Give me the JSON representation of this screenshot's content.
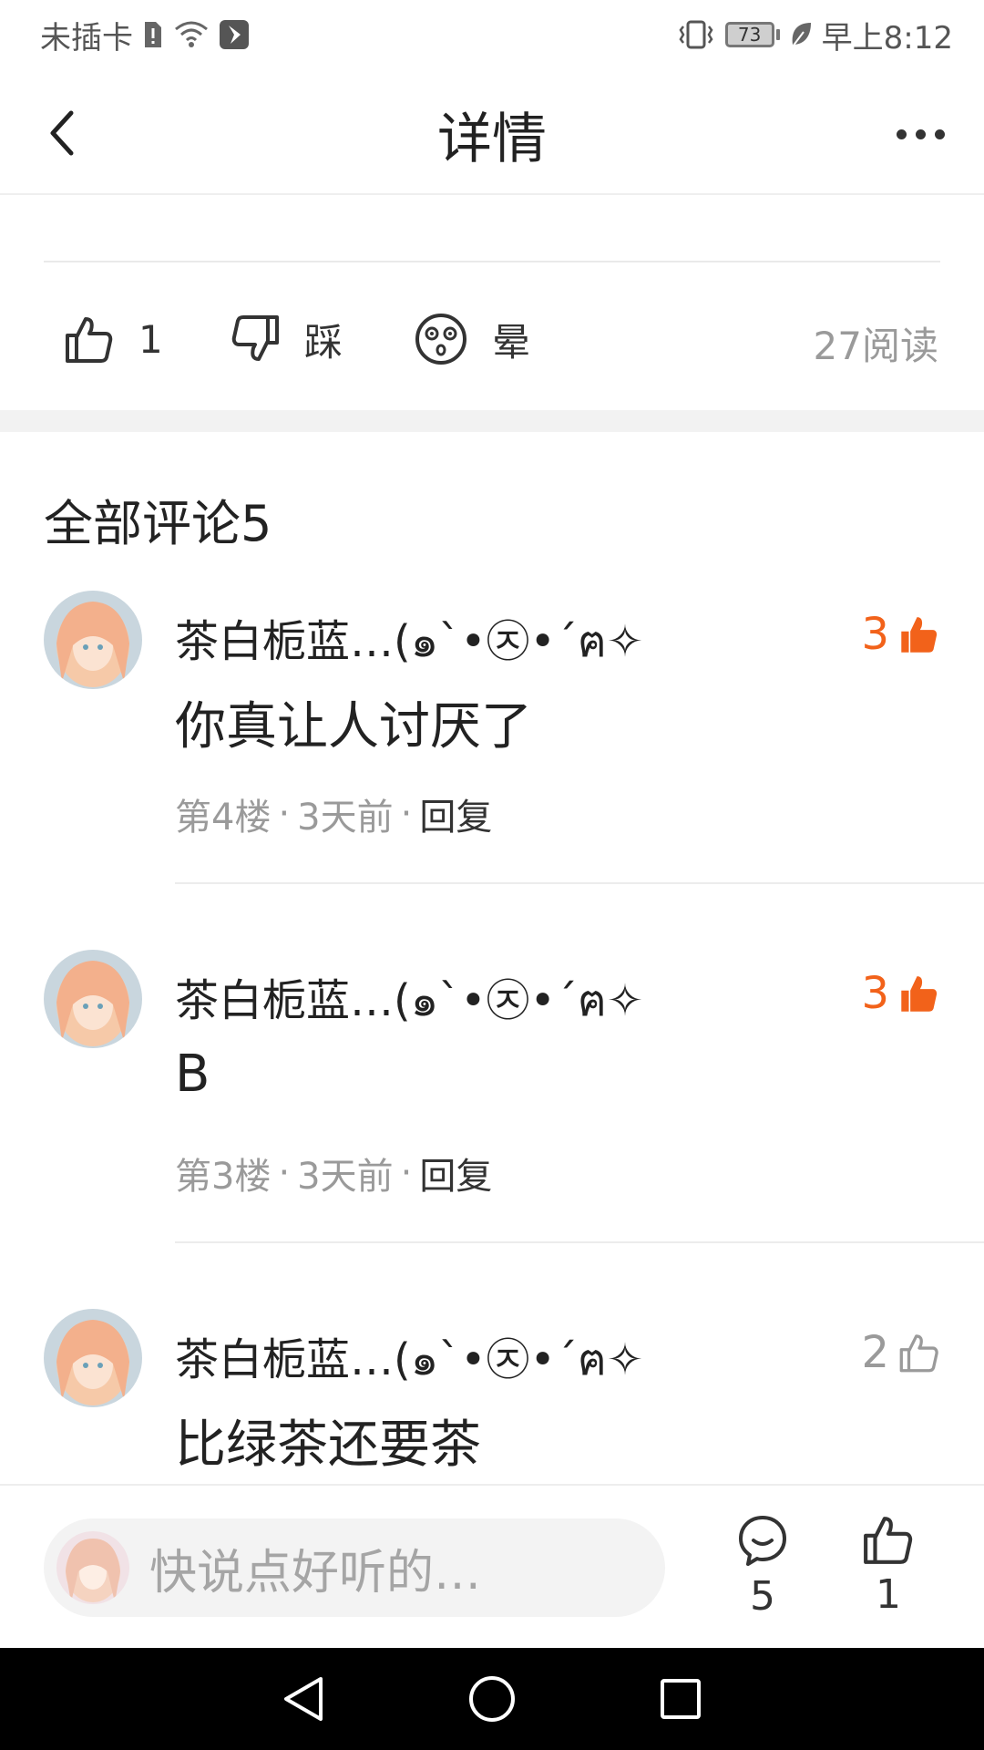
{
  "status_bar": {
    "carrier": "未插卡",
    "battery": "73",
    "time": "早上8:12"
  },
  "header": {
    "title": "详情"
  },
  "reactions": {
    "like_count": "1",
    "dislike_label": "踩",
    "dizzy_label": "晕",
    "read_count": "27阅读"
  },
  "comments_section": {
    "title": "全部评论5"
  },
  "comments": [
    {
      "name": "茶白栀蓝…(๑`•㉨•´ฅ✧",
      "text": "你真让人讨厌了",
      "floor": "第4楼",
      "time": "3天前",
      "reply": "回复",
      "likes": "3",
      "liked": true
    },
    {
      "name": "茶白栀蓝…(๑`•㉨•´ฅ✧",
      "text": "B",
      "floor": "第3楼",
      "time": "3天前",
      "reply": "回复",
      "likes": "3",
      "liked": true
    },
    {
      "name": "茶白栀蓝…(๑`•㉨•´ฅ✧",
      "text": "比绿茶还要茶",
      "floor": "",
      "time": "",
      "reply": "",
      "likes": "2",
      "liked": false
    }
  ],
  "bottom_bar": {
    "input_placeholder": "快说点好听的…",
    "comment_count": "5",
    "like_count": "1"
  },
  "colors": {
    "accent": "#f2621a",
    "muted": "#9a9a9a"
  }
}
